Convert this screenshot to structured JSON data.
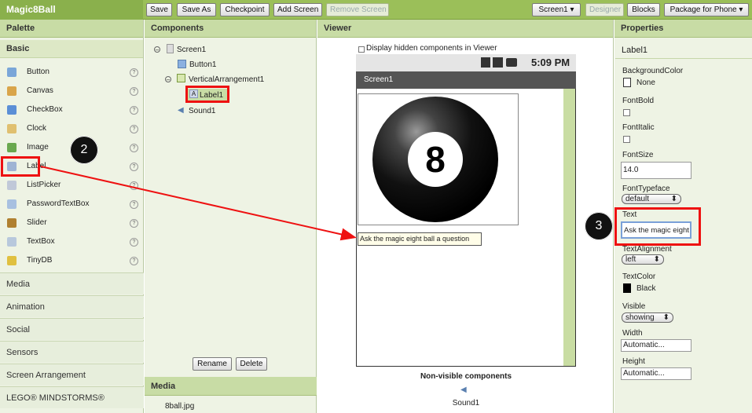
{
  "app": {
    "title": "Magic8Ball"
  },
  "toolbar": {
    "save": "Save",
    "save_as": "Save As",
    "checkpoint": "Checkpoint",
    "add_screen": "Add Screen",
    "remove_screen": "Remove Screen",
    "screen_select": "Screen1 ▾",
    "designer": "Designer",
    "blocks": "Blocks",
    "package": "Package for Phone ▾"
  },
  "palette": {
    "header": "Palette",
    "basic_label": "Basic",
    "items": [
      {
        "label": "Button",
        "icon": "button-icon",
        "color": "#7aa6d8"
      },
      {
        "label": "Canvas",
        "icon": "canvas-icon",
        "color": "#d9a54a"
      },
      {
        "label": "CheckBox",
        "icon": "checkbox-icon",
        "color": "#5b8fd6"
      },
      {
        "label": "Clock",
        "icon": "clock-icon",
        "color": "#e0c070"
      },
      {
        "label": "Image",
        "icon": "image-icon",
        "color": "#6aa84f"
      },
      {
        "label": "Label",
        "icon": "label-icon",
        "color": "#9fb4d4"
      },
      {
        "label": "ListPicker",
        "icon": "listpicker-icon",
        "color": "#c0c8d8"
      },
      {
        "label": "PasswordTextBox",
        "icon": "password-icon",
        "color": "#a8c0e0"
      },
      {
        "label": "Slider",
        "icon": "slider-icon",
        "color": "#b08030"
      },
      {
        "label": "TextBox",
        "icon": "textbox-icon",
        "color": "#b8c8dc"
      },
      {
        "label": "TinyDB",
        "icon": "database-icon",
        "color": "#e0c040"
      }
    ],
    "categories": [
      "Media",
      "Animation",
      "Social",
      "Sensors",
      "Screen Arrangement",
      "LEGO® MINDSTORMS®"
    ]
  },
  "components": {
    "header": "Components",
    "tree": [
      "Screen1",
      "Button1",
      "VerticalArrangement1",
      "Label1",
      "Sound1"
    ],
    "rename": "Rename",
    "delete": "Delete",
    "media_header": "Media",
    "media_file": "8ball.jpg"
  },
  "viewer": {
    "header": "Viewer",
    "hidden_checkbox": "Display hidden components in Viewer",
    "time": "5:09 PM",
    "screen_title": "Screen1",
    "ball_number": "8",
    "label_text": "Ask the magic eight ball a question",
    "nonvisible_header": "Non-visible components",
    "nonvisible_item": "Sound1"
  },
  "properties": {
    "header": "Properties",
    "component": "Label1",
    "background_color_label": "BackgroundColor",
    "background_color_value": "None",
    "font_bold_label": "FontBold",
    "font_italic_label": "FontItalic",
    "font_size_label": "FontSize",
    "font_size_value": "14.0",
    "font_typeface_label": "FontTypeface",
    "font_typeface_value": "default",
    "text_label": "Text",
    "text_value": "Ask the magic eight",
    "text_alignment_label": "TextAlignment",
    "text_alignment_value": "left",
    "text_color_label": "TextColor",
    "text_color_value": "Black",
    "visible_label": "Visible",
    "visible_value": "showing",
    "width_label": "Width",
    "width_value": "Automatic...",
    "height_label": "Height",
    "height_value": "Automatic..."
  },
  "annotations": {
    "step2": "2",
    "step3": "3"
  },
  "colors": {
    "topbar": "#9bbf59",
    "panel": "#eef3e4",
    "header": "#c8dca5",
    "highlight": "#e11111"
  }
}
